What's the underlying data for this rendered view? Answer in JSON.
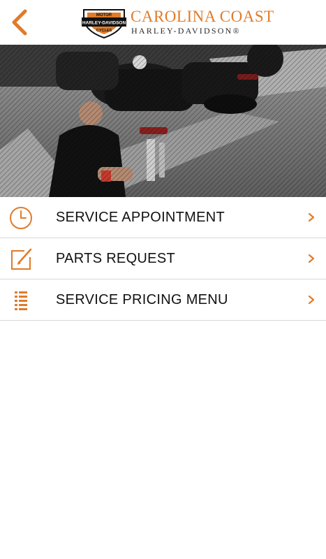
{
  "header": {
    "brand_line1": "CAROLINA COAST",
    "brand_line2": "HARLEY-DAVIDSON®",
    "shield_top": "MOTOR",
    "shield_middle": "HARLEY-DAVIDSON",
    "shield_bottom": "CYCLES"
  },
  "menu": {
    "items": [
      {
        "label": "SERVICE APPOINTMENT",
        "icon": "clock-icon"
      },
      {
        "label": "PARTS REQUEST",
        "icon": "edit-icon"
      },
      {
        "label": "SERVICE PRICING MENU",
        "icon": "list-icon"
      }
    ]
  },
  "colors": {
    "accent": "#e07b2a",
    "divider": "#d8d8d8",
    "text": "#111111"
  }
}
